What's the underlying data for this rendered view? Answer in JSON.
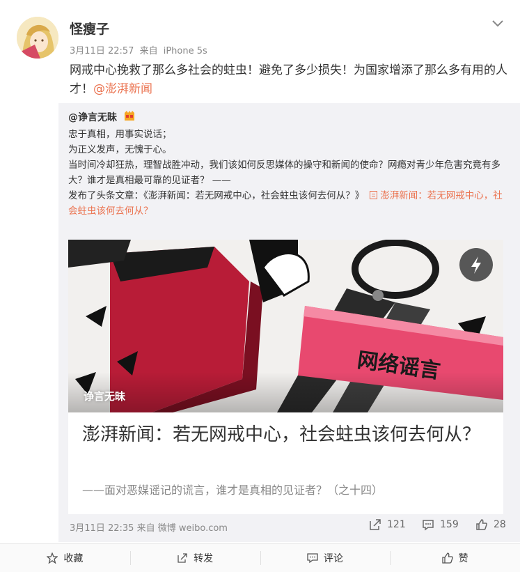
{
  "post": {
    "username": "怪瘦子",
    "date": "3月11日 22:57",
    "source_prefix": "来自",
    "device": "iPhone 5s",
    "text": "网戒中心挽救了那么多社会的蛀虫！避免了多少损失！为国家增添了那么多有用的人才！",
    "mention": "@澎湃新闻"
  },
  "repost": {
    "username": "@诤言无昧",
    "lines": [
      "忠于真相，用事实说话；",
      "为正义发声，无愧于心。",
      "当时间冷却狂热，理智战胜冲动，我们该如何反思媒体的操守和新闻的使命？网瘾对青少年危害究竟有多大？谁才是真相最可靠的见证者？ ——"
    ],
    "published_text": "发布了头条文章：《澎湃新闻：若无网戒中心，社会蛀虫该何去何从？》",
    "link_text": "澎湃新闻：若无网戒中心，社会蛀虫该何去何从？",
    "article": {
      "image_banner_text": "网络谣言",
      "image_source": "诤言无昧",
      "title": "澎湃新闻：若无网戒中心，社会蛀虫该何去何从？",
      "subtitle": "——面对恶媒谣记的谎言，谁才是真相的见证者？（之十四）"
    },
    "date": "3月11日 22:35",
    "source_prefix": "来自",
    "source": "微博 weibo.com",
    "reposts": "121",
    "comments": "159",
    "likes": "28"
  },
  "actions": {
    "favorite": "收藏",
    "forward": "转发",
    "comment": "评论",
    "like": "赞"
  },
  "icons": {
    "chevron": "chevron-down-icon",
    "flash": "lightning-icon",
    "doc": "document-icon",
    "star": "star-icon",
    "forward": "forward-icon",
    "comment": "comment-icon",
    "like": "thumbs-up-icon"
  },
  "colors": {
    "accent": "#eb7350",
    "repost_bg": "#f2f2f5",
    "meta_text": "#888888"
  }
}
